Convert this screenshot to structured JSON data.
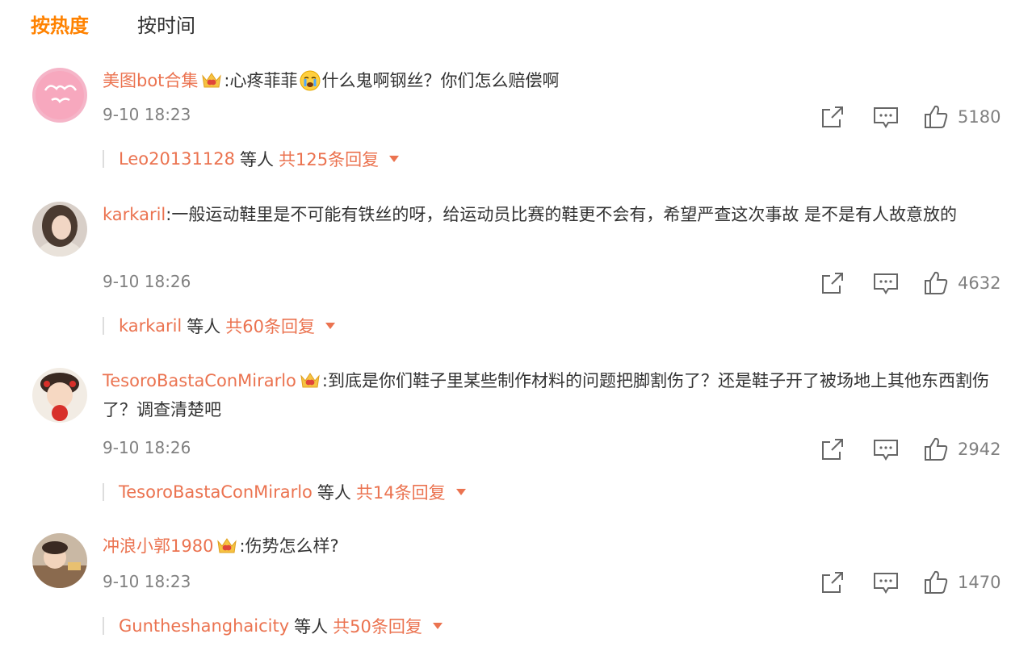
{
  "tabs": {
    "hot": "按热度",
    "time": "按时间"
  },
  "colors": {
    "accent": "#ff8200",
    "username": "#eb7350",
    "meta": "#808080",
    "text": "#333333"
  },
  "comments": [
    {
      "user": "美图bot合集",
      "has_badge": true,
      "text_a": ":心疼菲菲",
      "emoji": "crying-emoji",
      "text_b": "什么鬼啊钢丝？你们怎么赔偿啊",
      "time": "9-10 18:23",
      "likes": "5180",
      "reply_user": "Leo20131128",
      "reply_mid": "等人",
      "reply_count": "共125条回复"
    },
    {
      "user": "karkaril",
      "has_badge": false,
      "text_a": ":一般运动鞋里是不可能有铁丝的呀，给运动员比赛的鞋更不会有，希望严查这次事故 是不是有人故意放的",
      "time": "9-10 18:26",
      "likes": "4632",
      "reply_user": "karkaril",
      "reply_mid": "等人",
      "reply_count": "共60条回复"
    },
    {
      "user": "TesoroBastaConMirarlo",
      "has_badge": true,
      "text_a": ":到底是你们鞋子里某些制作材料的问题把脚割伤了？还是鞋子开了被场地上其他东西割伤了？调查清楚吧",
      "time": "9-10 18:26",
      "likes": "2942",
      "reply_user": "TesoroBastaConMirarlo",
      "reply_mid": "等人",
      "reply_count": "共14条回复"
    },
    {
      "user": "冲浪小郭1980",
      "has_badge": true,
      "text_a": ":伤势怎么样?",
      "time": "9-10 18:23",
      "likes": "1470",
      "reply_user": "Guntheshanghaicity",
      "reply_mid": "等人",
      "reply_count": "共50条回复"
    }
  ],
  "avatar_images": {
    "avatar_1_text": "美图bot合集"
  }
}
